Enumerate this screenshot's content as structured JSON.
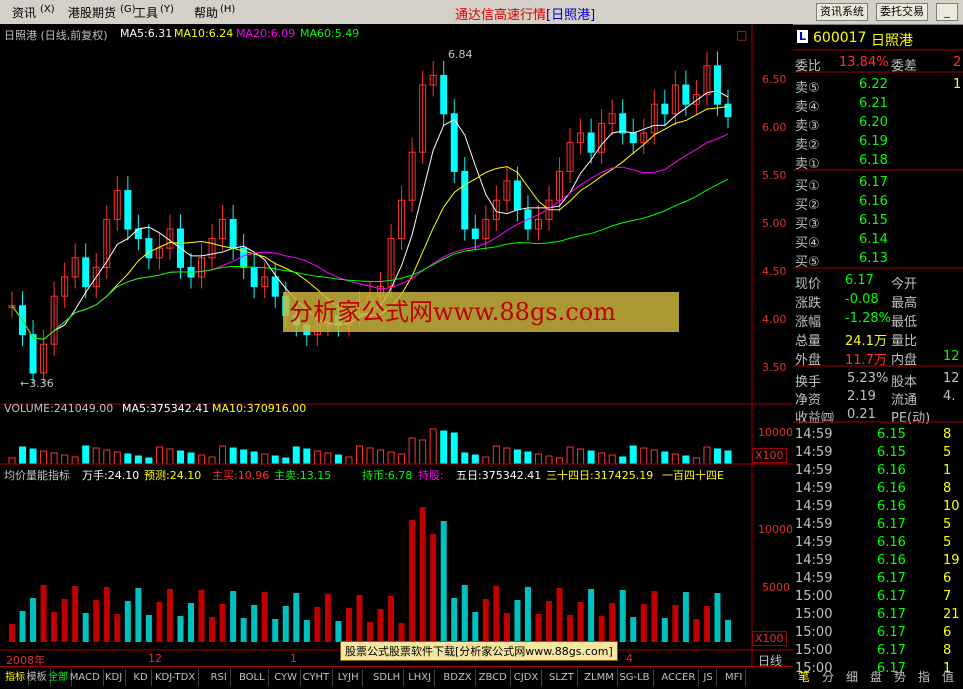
{
  "menu": {
    "items": [
      "资讯",
      "港股期货",
      "工具",
      "帮助"
    ],
    "title": "通达信高速行情",
    "title_code": "[日照港]",
    "btn_info": "资讯系统",
    "btn_trade": "委托交易"
  },
  "kline": {
    "title": "日照港 (日线,前复权)",
    "ma5": "MA5:6.31",
    "ma10": "MA10:6.24",
    "ma20": "MA20:6.09",
    "ma60": "MA60:5.49",
    "high_label": "6.84",
    "low_label": "←3.36",
    "yaxis": [
      "6.50",
      "6.00",
      "5.50",
      "5.00",
      "4.50",
      "4.00",
      "3.50"
    ],
    "colors": {
      "ma5": "#ffffff",
      "ma10": "#ffff00",
      "ma20": "#ff00ff",
      "ma60": "#00ff00",
      "up": "#ff3030",
      "down": "#00ffff"
    }
  },
  "volume": {
    "label": "VOLUME:241049.00",
    "ma5": "MA5:375342.41",
    "ma10": "MA10:370916.00",
    "yaxis": "10000",
    "unit": "X100"
  },
  "indicator": {
    "name": "均价量能指标",
    "wanshou": "万手:24.10",
    "yuce": "预测:24.10",
    "zhumai": "主买:10.96",
    "zhumai2": "主卖:13.15",
    "chibi": "持币:6.78",
    "chigu": "持股:",
    "wuri": "五日:375342.41",
    "sanshisi": "三十四日:317425.19",
    "yibai": "一百四十四E",
    "yaxis": [
      "10000",
      "5000"
    ],
    "unit": "X100"
  },
  "xaxis": {
    "labels": [
      "2008年",
      "12",
      "1",
      "4"
    ],
    "day_label": "日线"
  },
  "watermark": "分析家公式网www.88gs.com",
  "footer_ad": "股票公式股票软件下载[分析家公式网www.88gs.com]",
  "tabs": [
    "指标",
    "模板",
    "全部",
    "MACD",
    "KDJ",
    "KD",
    "KDJ-TDX",
    "RSI",
    "BOLL",
    "CYW",
    "CYHT",
    "LYJH",
    "SDLH",
    "LHXJ",
    "BDZX",
    "ZBCD",
    "CJDX",
    "SLZT",
    "ZLMM",
    "SG-LB",
    "ACCER",
    "JS",
    "MFI"
  ],
  "bottom_tabs": [
    "笔",
    "分",
    "细",
    "盘",
    "势",
    "指",
    "值"
  ],
  "quote": {
    "code": "600017",
    "name": "日照港",
    "logo": "L",
    "weibi_label": "委比",
    "weibi": "13.84%",
    "weicha_label": "委差",
    "weicha": "2",
    "asks": [
      {
        "l": "卖⑤",
        "p": "6.22",
        "v": "1"
      },
      {
        "l": "卖④",
        "p": "6.21",
        "v": ""
      },
      {
        "l": "卖③",
        "p": "6.20",
        "v": ""
      },
      {
        "l": "卖②",
        "p": "6.19",
        "v": ""
      },
      {
        "l": "卖①",
        "p": "6.18",
        "v": ""
      }
    ],
    "bids": [
      {
        "l": "买①",
        "p": "6.17",
        "v": ""
      },
      {
        "l": "买②",
        "p": "6.16",
        "v": ""
      },
      {
        "l": "买③",
        "p": "6.15",
        "v": ""
      },
      {
        "l": "买④",
        "p": "6.14",
        "v": ""
      },
      {
        "l": "买⑤",
        "p": "6.13",
        "v": ""
      }
    ],
    "stats": [
      {
        "l": "现价",
        "v": "6.17",
        "l2": "今开",
        "c": "#00ff00"
      },
      {
        "l": "涨跌",
        "v": "-0.08",
        "l2": "最高",
        "c": "#00ff00"
      },
      {
        "l": "涨幅",
        "v": "-1.28%",
        "l2": "最低",
        "c": "#00ff00"
      },
      {
        "l": "总量",
        "v": "24.1万",
        "l2": "量比",
        "c": "#ffff00"
      },
      {
        "l": "外盘",
        "v": "11.7万",
        "l2": "内盘",
        "c": "#ff3030",
        "v2": "12"
      }
    ],
    "stats2": [
      {
        "l": "换手",
        "v": "5.23%",
        "l2": "股本",
        "v2": "12"
      },
      {
        "l": "净资",
        "v": "2.19",
        "l2": "流通",
        "v2": "4."
      },
      {
        "l": "收益㈣",
        "v": "0.21",
        "l2": "PE(动)",
        "v2": ""
      }
    ],
    "ticks": [
      {
        "t": "14:59",
        "p": "6.15",
        "v": "8"
      },
      {
        "t": "14:59",
        "p": "6.15",
        "v": "5"
      },
      {
        "t": "14:59",
        "p": "6.16",
        "v": "1"
      },
      {
        "t": "14:59",
        "p": "6.16",
        "v": "8"
      },
      {
        "t": "14:59",
        "p": "6.16",
        "v": "10"
      },
      {
        "t": "14:59",
        "p": "6.17",
        "v": "5"
      },
      {
        "t": "14:59",
        "p": "6.16",
        "v": "5"
      },
      {
        "t": "14:59",
        "p": "6.16",
        "v": "19"
      },
      {
        "t": "14:59",
        "p": "6.17",
        "v": "6"
      },
      {
        "t": "15:00",
        "p": "6.17",
        "v": "7"
      },
      {
        "t": "15:00",
        "p": "6.17",
        "v": "21"
      },
      {
        "t": "15:00",
        "p": "6.17",
        "v": "6"
      },
      {
        "t": "15:00",
        "p": "6.17",
        "v": "8"
      },
      {
        "t": "15:00",
        "p": "6.17",
        "v": "1"
      }
    ]
  }
}
